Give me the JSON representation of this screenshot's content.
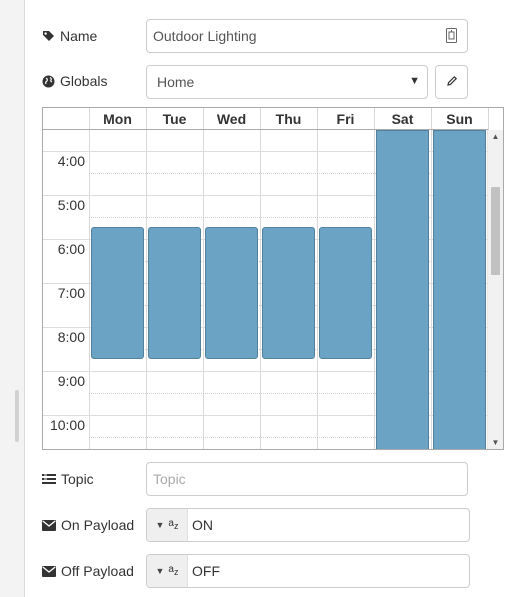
{
  "name": {
    "label": "Name",
    "value": "Outdoor Lighting"
  },
  "globals": {
    "label": "Globals",
    "value": "Home"
  },
  "schedule": {
    "days": [
      "Mon",
      "Tue",
      "Wed",
      "Thu",
      "Fri",
      "Sat",
      "Sun"
    ],
    "times": [
      "4:00",
      "5:00",
      "6:00",
      "7:00",
      "8:00",
      "9:00",
      "10:00"
    ],
    "block_color": "#6ba3c5",
    "blocks": [
      {
        "day": "Mon",
        "start": "6:00",
        "end": "9:00"
      },
      {
        "day": "Tue",
        "start": "6:00",
        "end": "9:00"
      },
      {
        "day": "Wed",
        "start": "6:00",
        "end": "9:00"
      },
      {
        "day": "Thu",
        "start": "6:00",
        "end": "9:00"
      },
      {
        "day": "Fri",
        "start": "6:00",
        "end": "9:00"
      },
      {
        "day": "Sat",
        "start": "all-day",
        "end": "all-day"
      },
      {
        "day": "Sun",
        "start": "all-day",
        "end": "all-day"
      }
    ]
  },
  "topic": {
    "label": "Topic",
    "placeholder": "Topic"
  },
  "on_payload": {
    "label": "On Payload",
    "value": "ON",
    "type_icon": "az-string-icon"
  },
  "off_payload": {
    "label": "Off Payload",
    "value": "OFF",
    "type_icon": "az-string-icon"
  }
}
